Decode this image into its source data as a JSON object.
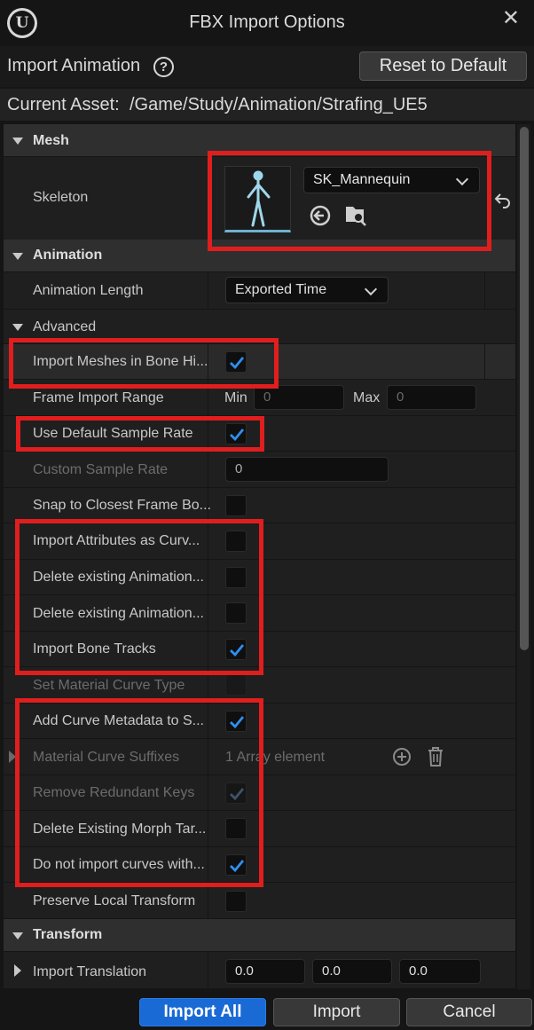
{
  "window": {
    "title": "FBX Import Options"
  },
  "toolbar": {
    "title": "Import Animation",
    "reset_label": "Reset to Default"
  },
  "asset": {
    "label": "Current Asset:",
    "path": "/Game/Study/Animation/Strafing_UE5"
  },
  "mesh": {
    "category": "Mesh",
    "skeleton_label": "Skeleton",
    "skeleton_value": "SK_Mannequin"
  },
  "animation": {
    "category": "Animation",
    "length_label": "Animation Length",
    "length_value": "Exported Time",
    "advanced_label": "Advanced"
  },
  "rows": {
    "import_meshes": {
      "label": "Import Meshes in Bone Hi...",
      "checked": true
    },
    "frame_range": {
      "label": "Frame Import Range",
      "min_label": "Min",
      "min_value": "0",
      "max_label": "Max",
      "max_value": "0"
    },
    "default_sample_rate": {
      "label": "Use Default Sample Rate",
      "checked": true
    },
    "custom_sample_rate": {
      "label": "Custom Sample Rate",
      "value": "0"
    },
    "snap_frame": {
      "label": "Snap to Closest Frame Bo...",
      "checked": false
    },
    "import_attributes": {
      "label": "Import Attributes as Curv...",
      "checked": false
    },
    "delete_anim_1": {
      "label": "Delete existing Animation...",
      "checked": false
    },
    "delete_anim_2": {
      "label": "Delete existing Animation...",
      "checked": false
    },
    "import_bone_tracks": {
      "label": "Import Bone Tracks",
      "checked": true
    },
    "material_curve_type": {
      "label": "Set Material Curve Type",
      "checked": false
    },
    "add_curve_metadata": {
      "label": "Add Curve Metadata to S...",
      "checked": true
    },
    "material_curve_suffixes": {
      "label": "Material Curve Suffixes",
      "value": "1 Array element"
    },
    "remove_redundant": {
      "label": "Remove Redundant Keys",
      "checked": true
    },
    "delete_morph": {
      "label": "Delete Existing Morph Tar...",
      "checked": false
    },
    "no_import_curves": {
      "label": "Do not import curves with...",
      "checked": true
    },
    "preserve_local": {
      "label": "Preserve Local Transform",
      "checked": false
    }
  },
  "transform": {
    "category": "Transform",
    "translation_label": "Import Translation",
    "tx": "0.0",
    "ty": "0.0",
    "tz": "0.0"
  },
  "footer": {
    "import_all": "Import All",
    "import": "Import",
    "cancel": "Cancel"
  },
  "colors": {
    "accent": "#1a6ad6",
    "check": "#2e8ff0",
    "highlight": "#e01e1e"
  }
}
